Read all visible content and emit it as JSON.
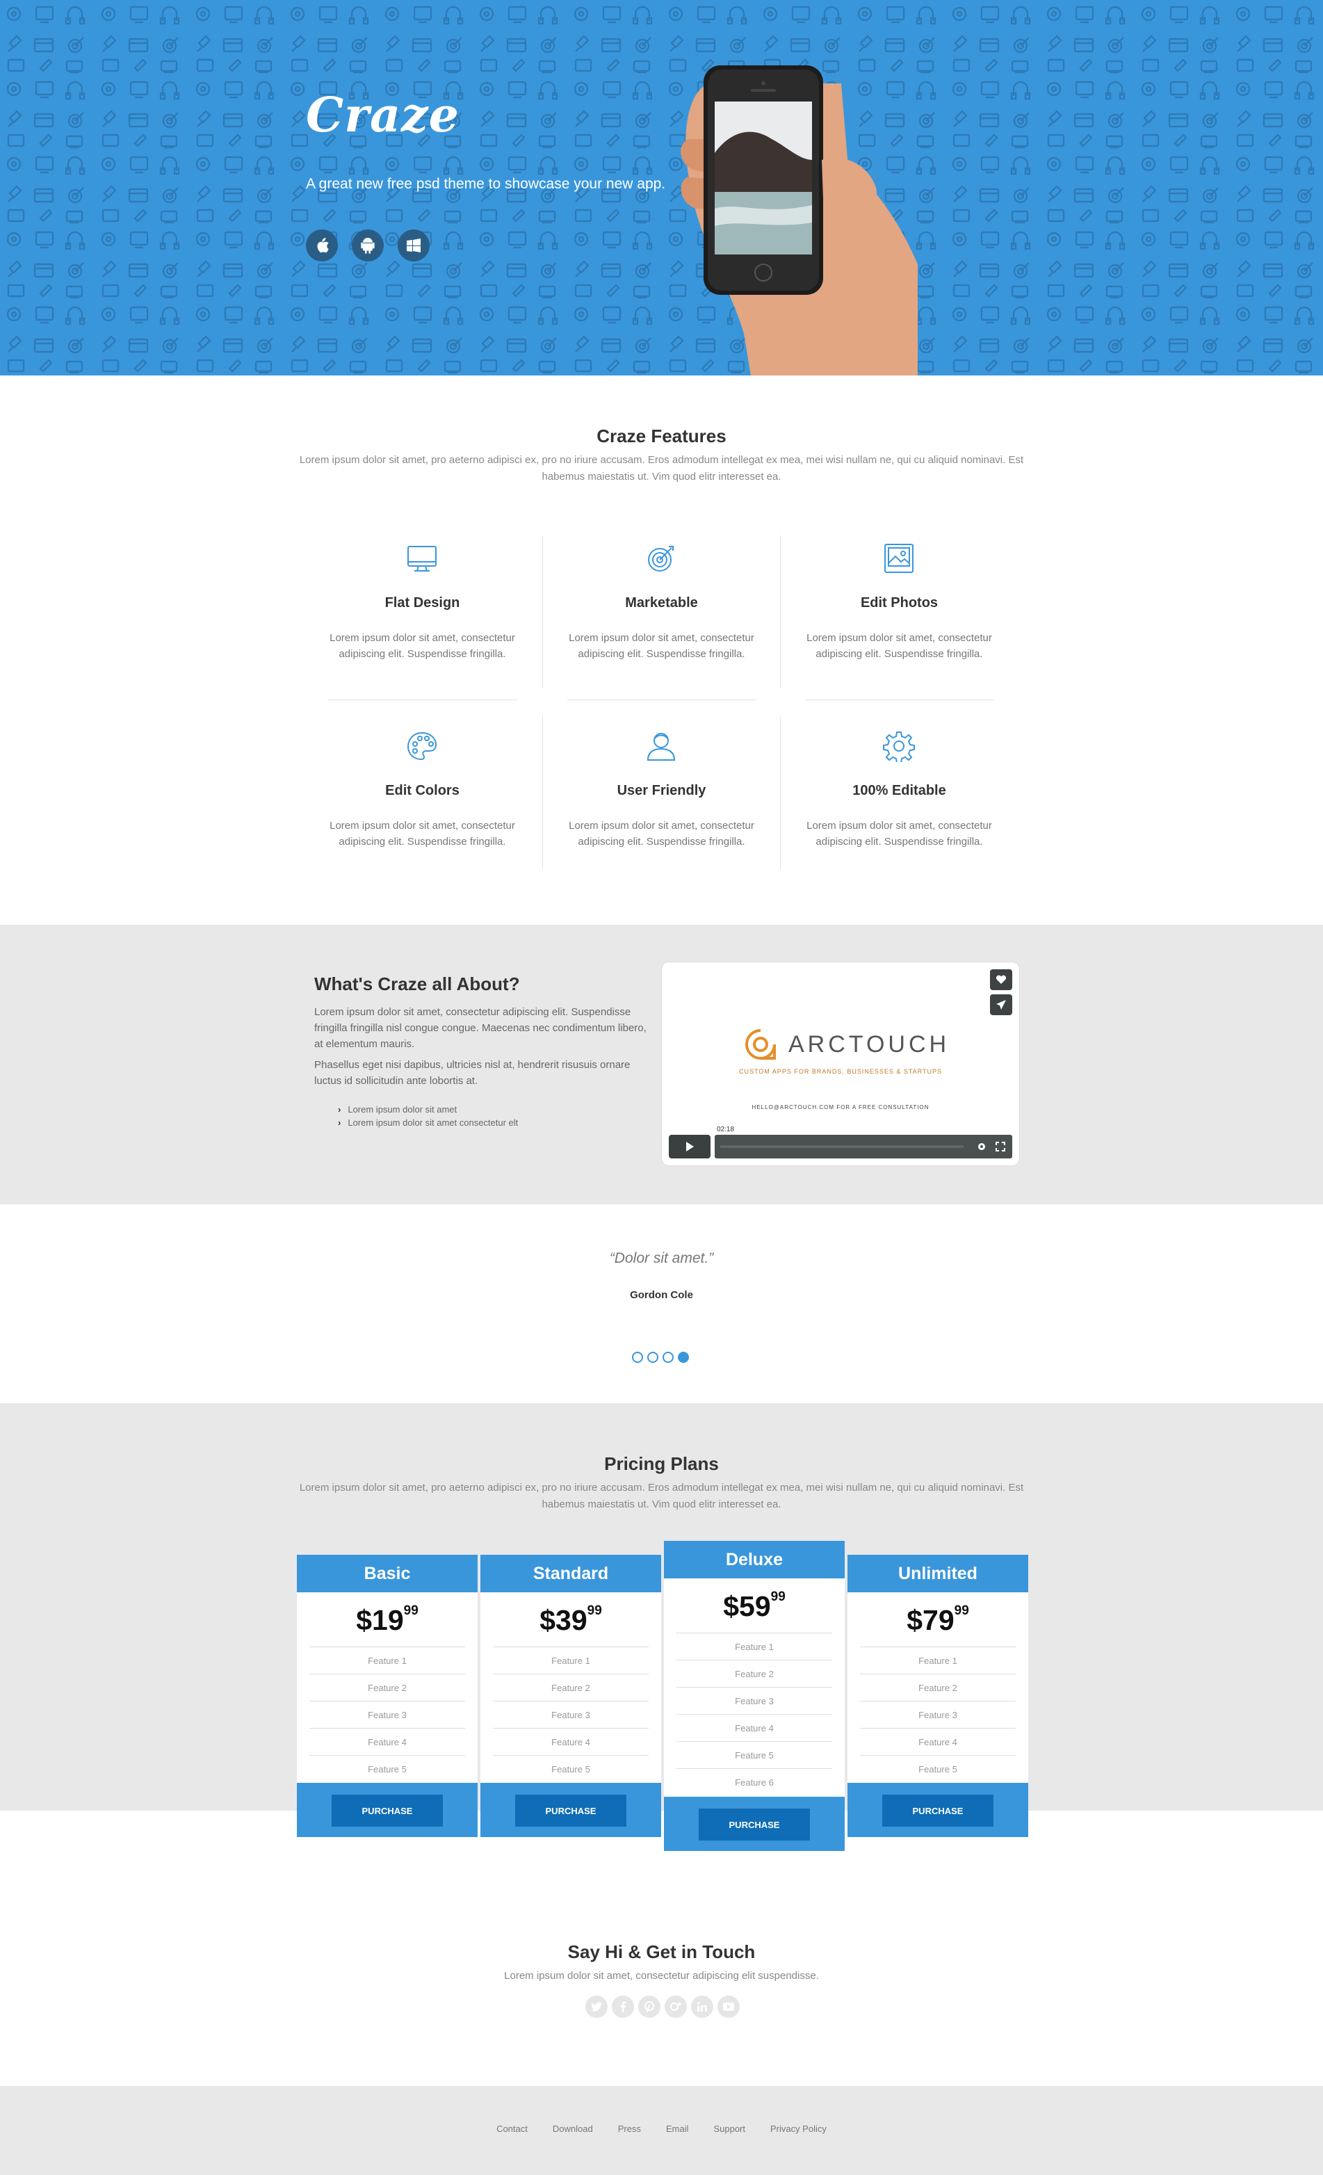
{
  "hero": {
    "logo": "Craze",
    "tagline": "A great new free psd theme to showcase your new app.",
    "store_icons": [
      "apple-icon",
      "android-icon",
      "windows-icon"
    ]
  },
  "features": {
    "title": "Craze Features",
    "subtitle": "Lorem ipsum dolor sit amet, pro aeterno adipisci ex, pro no iriure accusam. Eros admodum intellegat ex mea, mei wisi nullam ne, qui cu aliquid nominavi. Est habemus maiestatis ut. Vim quod elitr interesset ea.",
    "items": [
      {
        "icon": "monitor-icon",
        "title": "Flat Design",
        "desc": "Lorem ipsum dolor sit amet, consectetur adipiscing elit. Suspendisse fringilla."
      },
      {
        "icon": "target-icon",
        "title": "Marketable",
        "desc": "Lorem ipsum dolor sit amet, consectetur adipiscing elit. Suspendisse fringilla."
      },
      {
        "icon": "image-icon",
        "title": "Edit Photos",
        "desc": "Lorem ipsum dolor sit amet, consectetur adipiscing elit. Suspendisse fringilla."
      },
      {
        "icon": "palette-icon",
        "title": "Edit Colors",
        "desc": "Lorem ipsum dolor sit amet, consectetur adipiscing elit. Suspendisse fringilla."
      },
      {
        "icon": "user-icon",
        "title": "User Friendly",
        "desc": "Lorem ipsum dolor sit amet, consectetur adipiscing elit. Suspendisse fringilla."
      },
      {
        "icon": "gear-icon",
        "title": "100% Editable",
        "desc": "Lorem ipsum dolor sit amet, consectetur adipiscing elit. Suspendisse fringilla."
      }
    ]
  },
  "about": {
    "title": "What's Craze all About?",
    "p1": "Lorem ipsum dolor sit amet, consectetur adipiscing elit. Suspendisse fringilla fringilla nisl congue congue. Maecenas nec condimentum libero, at elementum mauris.",
    "p2": "Phasellus eget nisi dapibus, ultricies nisl at, hendrerit risusuis ornare luctus id sollicitudin ante lobortis at.",
    "list": [
      "Lorem ipsum dolor sit amet",
      "Lorem ipsum dolor sit amet consectetur elt"
    ],
    "video": {
      "brand": "ARCTOUCH",
      "tagline": "CUSTOM APPS FOR BRANDS, BUSINESSES & STARTUPS",
      "email": "HELLO@ARCTOUCH.COM FOR A FREE CONSULTATION",
      "time": "02:18"
    }
  },
  "testimonial": {
    "quote": "“Dolor sit amet.”",
    "author": "Gordon Cole",
    "slides": 4,
    "active_slide": 4
  },
  "pricing": {
    "title": "Pricing Plans",
    "subtitle": "Lorem ipsum dolor sit amet, pro aeterno adipisci ex, pro no iriure accusam. Eros admodum intellegat ex mea, mei wisi nullam ne, qui cu aliquid nominavi. Est habemus maiestatis ut. Vim quod elitr interesset ea.",
    "plans": [
      {
        "name": "Basic",
        "price": "$19",
        "cents": "99",
        "features": [
          "Feature 1",
          "Feature 2",
          "Feature 3",
          "Feature 4",
          "Feature 5"
        ],
        "button": "PURCHASE"
      },
      {
        "name": "Standard",
        "price": "$39",
        "cents": "99",
        "features": [
          "Feature 1",
          "Feature 2",
          "Feature 3",
          "Feature 4",
          "Feature 5"
        ],
        "button": "PURCHASE"
      },
      {
        "name": "Deluxe",
        "price": "$59",
        "cents": "99",
        "features": [
          "Feature 1",
          "Feature 2",
          "Feature 3",
          "Feature 4",
          "Feature 5",
          "Feature 6"
        ],
        "button": "PURCHASE"
      },
      {
        "name": "Unlimited",
        "price": "$79",
        "cents": "99",
        "features": [
          "Feature 1",
          "Feature 2",
          "Feature 3",
          "Feature 4",
          "Feature 5"
        ],
        "button": "PURCHASE"
      }
    ]
  },
  "contact": {
    "title": "Say Hi & Get in Touch",
    "subtitle": "Lorem ipsum dolor sit amet, consectetur adipiscing elit suspendisse.",
    "social": [
      "twitter-icon",
      "facebook-icon",
      "pinterest-icon",
      "google-plus-icon",
      "linkedin-icon",
      "youtube-icon"
    ]
  },
  "footer": {
    "links": [
      "Contact",
      "Download",
      "Press",
      "Email",
      "Support",
      "Privacy Policy"
    ]
  },
  "colors": {
    "primary": "#3a96db",
    "button": "#0e6db6",
    "gray_bg": "#e8e8e8"
  }
}
